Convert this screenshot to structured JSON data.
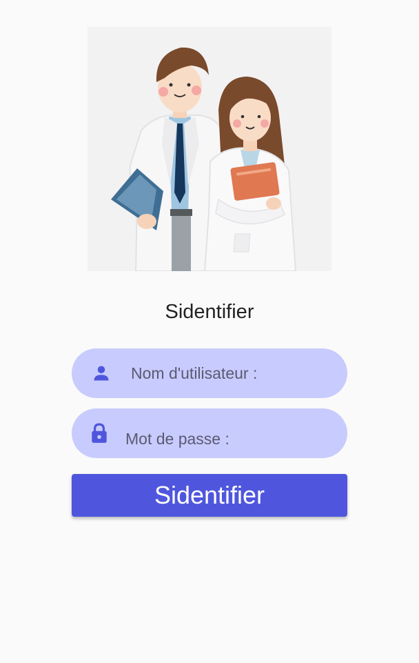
{
  "login": {
    "title": "Sidentifier",
    "username": {
      "placeholder": "Nom d'utilisateur :",
      "value": "",
      "icon": "person-icon"
    },
    "password": {
      "placeholder": "Mot de passe :",
      "value": "",
      "icon": "lock-icon"
    },
    "submit_label": "Sidentifier"
  },
  "colors": {
    "background": "#fafafa",
    "field_background": "#c8cbfd",
    "accent": "#4f56dd",
    "icon": "#4f56dd"
  },
  "hero": {
    "illustration": "doctors-illustration"
  }
}
